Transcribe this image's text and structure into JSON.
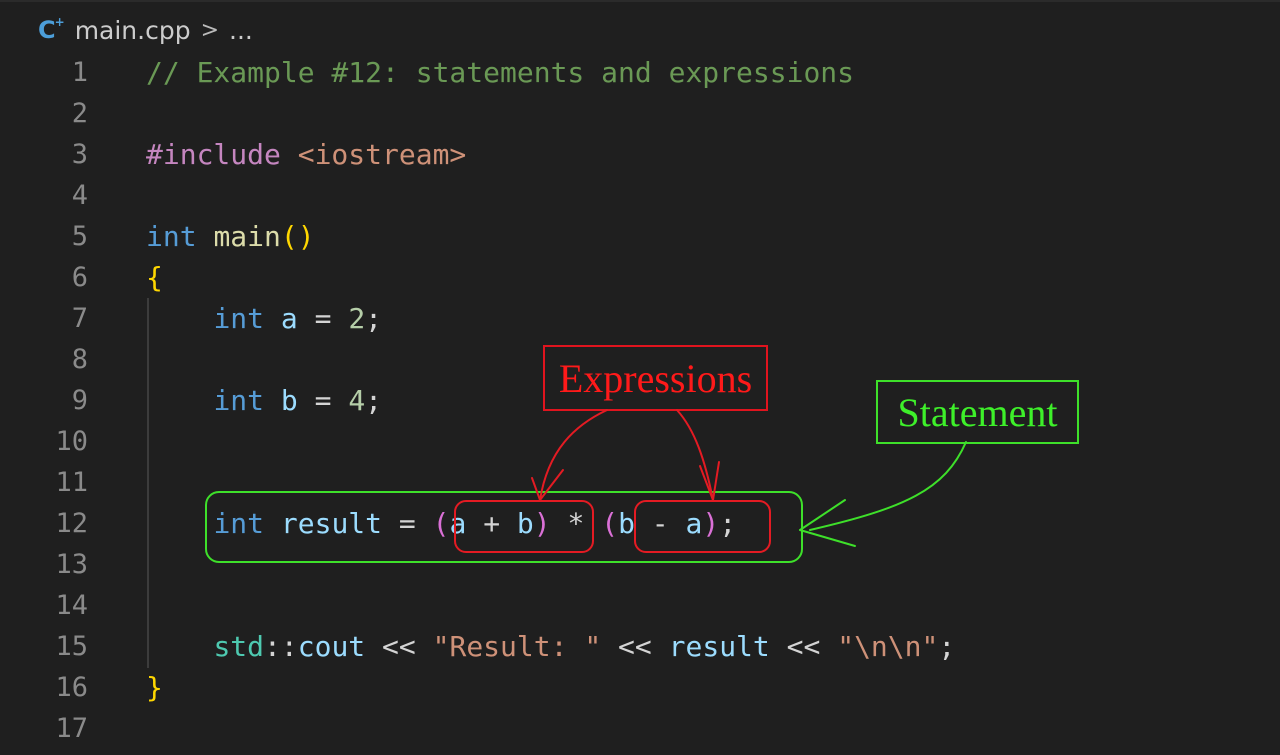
{
  "breadcrumb": {
    "file_icon_text": "C",
    "file_icon_sup": "+",
    "file_name": "main.cpp",
    "separator": ">",
    "more": "..."
  },
  "lines": [
    {
      "num": "1",
      "text": "// Example #12: statements and expressions"
    },
    {
      "num": "2",
      "text": ""
    },
    {
      "num": "3",
      "text": "#include <iostream>"
    },
    {
      "num": "4",
      "text": ""
    },
    {
      "num": "5",
      "text": "int main()"
    },
    {
      "num": "6",
      "text": "{"
    },
    {
      "num": "7",
      "text": "    int a = 2;"
    },
    {
      "num": "8",
      "text": ""
    },
    {
      "num": "9",
      "text": "    int b = 4;"
    },
    {
      "num": "10",
      "text": ""
    },
    {
      "num": "11",
      "text": ""
    },
    {
      "num": "12",
      "text": "    int result = (a + b) * (b - a);"
    },
    {
      "num": "13",
      "text": ""
    },
    {
      "num": "14",
      "text": ""
    },
    {
      "num": "15",
      "text": "    std::cout << \"Result: \" << result << \"\\n\\n\";"
    },
    {
      "num": "16",
      "text": "}"
    },
    {
      "num": "17",
      "text": ""
    }
  ],
  "tokens": {
    "l1_comment": "// Example #12: statements and expressions",
    "l3_include": "#include",
    "l3_header": "<iostream>",
    "l5_int": "int",
    "l5_main": "main",
    "l5_parens": "()",
    "l6_open": "{",
    "l7_int": "int",
    "l7_a": "a",
    "l7_eq": "=",
    "l7_val": "2",
    "l7_semi": ";",
    "l9_int": "int",
    "l9_b": "b",
    "l9_eq": "=",
    "l9_val": "4",
    "l9_semi": ";",
    "l12_int": "int",
    "l12_result": "result",
    "l12_eq": "=",
    "l12_lp1": "(",
    "l12_a1": "a",
    "l12_plus": "+",
    "l12_b1": "b",
    "l12_rp1": ")",
    "l12_mul": "*",
    "l12_lp2": "(",
    "l12_b2": "b",
    "l12_minus": "-",
    "l12_a2": "a",
    "l12_rp2": ")",
    "l12_semi": ";",
    "l15_std": "std",
    "l15_scope": "::",
    "l15_cout": "cout",
    "l15_shl1": "<<",
    "l15_str1": "\"Result: \"",
    "l15_shl2": "<<",
    "l15_result": "result",
    "l15_shl3": "<<",
    "l15_str2": "\"\\n\\n\"",
    "l15_semi": ";",
    "l16_close": "}"
  },
  "annotations": {
    "expressions_label": "Expressions",
    "statement_label": "Statement",
    "red_color": "#e0141e",
    "green_color": "#3ee02a"
  },
  "theme": {
    "background": "#1f1f1f",
    "comment": "#6a9955",
    "keyword": "#569cd6",
    "string": "#ce9178",
    "variable": "#9cdcfe",
    "function": "#dcdcaa",
    "number": "#b5cea8",
    "preprocessor": "#c586c0",
    "namespace": "#4ec9b0",
    "brace": "#ffd700"
  }
}
